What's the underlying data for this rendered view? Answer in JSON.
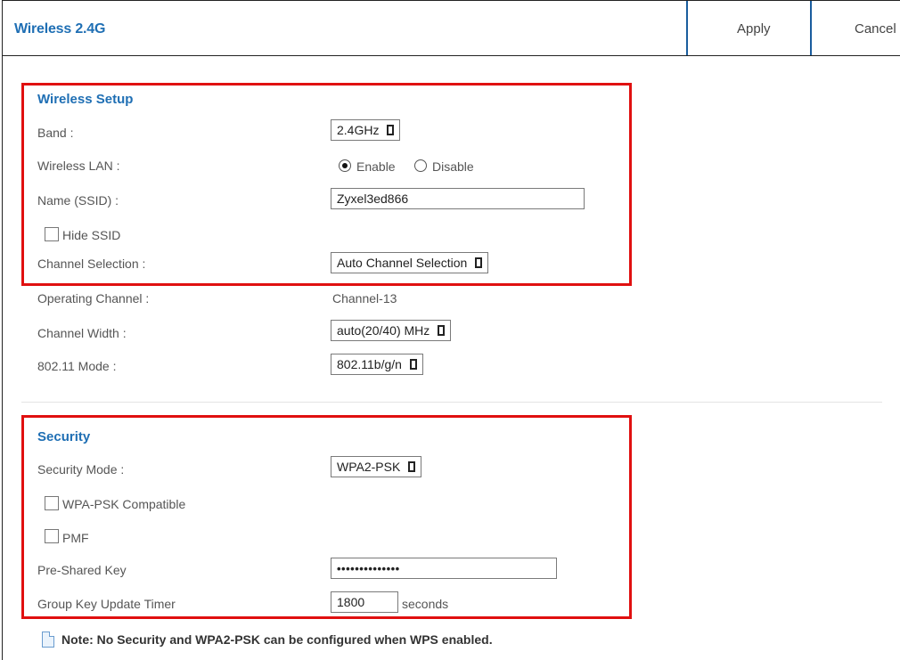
{
  "header": {
    "title": "Wireless 2.4G",
    "apply_label": "Apply",
    "cancel_label": "Cancel"
  },
  "wireless_setup": {
    "title": "Wireless Setup",
    "band": {
      "label": "Band :",
      "value": "2.4GHz"
    },
    "wireless_lan": {
      "label": "Wireless LAN :",
      "enable_label": "Enable",
      "disable_label": "Disable",
      "selected": "Enable"
    },
    "ssid": {
      "label": "Name (SSID) :",
      "value": "Zyxel3ed866"
    },
    "hide_ssid": {
      "label": "Hide SSID",
      "checked": false
    },
    "channel_selection": {
      "label": "Channel Selection :",
      "value": "Auto Channel Selection"
    }
  },
  "operating_channel": {
    "label": "Operating Channel :",
    "value": "Channel-13"
  },
  "channel_width": {
    "label": "Channel Width :",
    "value": "auto(20/40) MHz"
  },
  "mode_80211": {
    "label": "802.11 Mode :",
    "value": "802.11b/g/n"
  },
  "security": {
    "title": "Security",
    "mode": {
      "label": "Security Mode :",
      "value": "WPA2-PSK"
    },
    "wpa_psk_compatible": {
      "label": "WPA-PSK Compatible",
      "checked": false
    },
    "pmf": {
      "label": "PMF",
      "checked": false
    },
    "psk": {
      "label": "Pre-Shared Key",
      "value": "••••••••••••••"
    },
    "group_key_timer": {
      "label": "Group Key Update Timer",
      "value": "1800",
      "unit": "seconds"
    }
  },
  "note": {
    "text": "Note: No Security and WPA2-PSK can be configured when WPS enabled.",
    "icon": "note-icon"
  },
  "colors": {
    "accent": "#1f6fb4",
    "highlight_border": "#e01010",
    "button_border": "#1a5d9e"
  }
}
